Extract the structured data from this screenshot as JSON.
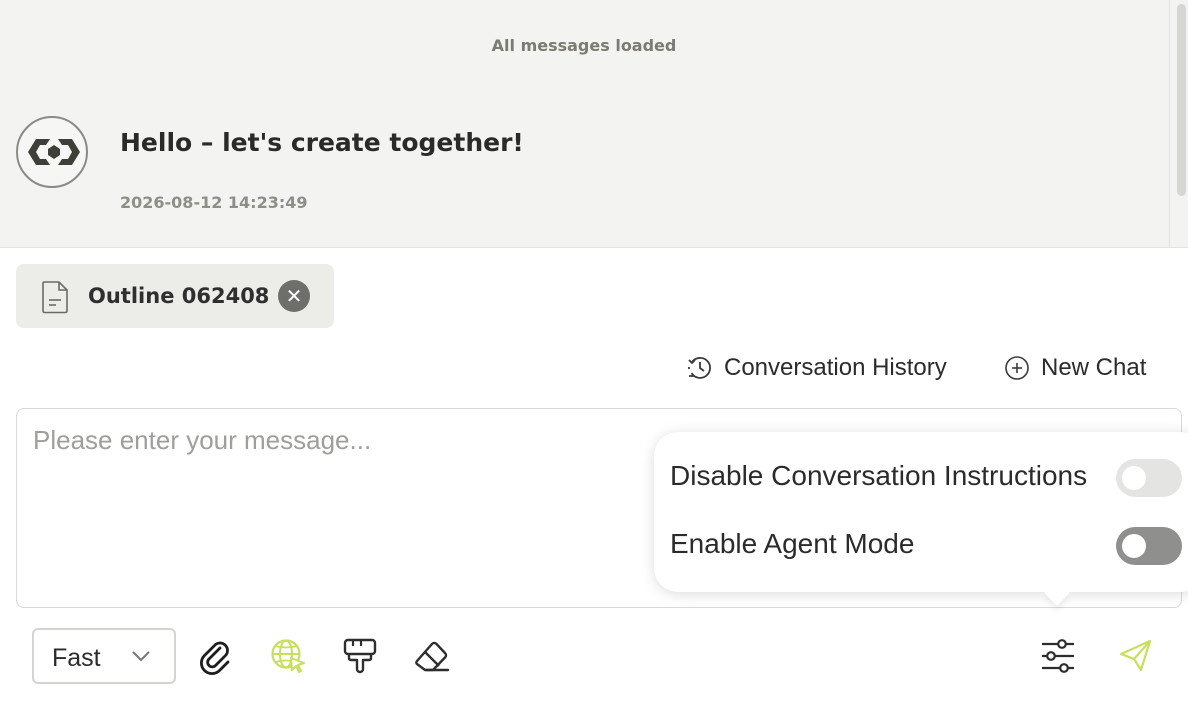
{
  "chat": {
    "loaded_note": "All messages loaded",
    "message": {
      "text": "Hello – let's create together!",
      "timestamp": "2026-08-12 14:23:49"
    }
  },
  "attachment": {
    "label": "Outline 062408",
    "close_symbol": "✕"
  },
  "actions": {
    "history_label": "Conversation History",
    "new_chat_label": "New Chat"
  },
  "composer": {
    "placeholder": "Please enter your message..."
  },
  "popover": {
    "items": [
      {
        "label": "Disable Conversation Instructions",
        "enabled": false
      },
      {
        "label": "Enable Agent Mode",
        "enabled": false
      }
    ]
  },
  "toolbar": {
    "mode_value": "Fast",
    "icons": [
      "paperclip-icon",
      "globe-cursor-icon",
      "brush-icon",
      "eraser-icon",
      "sliders-icon",
      "send-icon"
    ]
  },
  "colors": {
    "accent": "#c6e05a",
    "chat_background": "#f3f3f1",
    "chip_background": "#ecece8",
    "toggle_off": "#e4e4e2",
    "toggle_off_dark": "#8f8f8d"
  }
}
